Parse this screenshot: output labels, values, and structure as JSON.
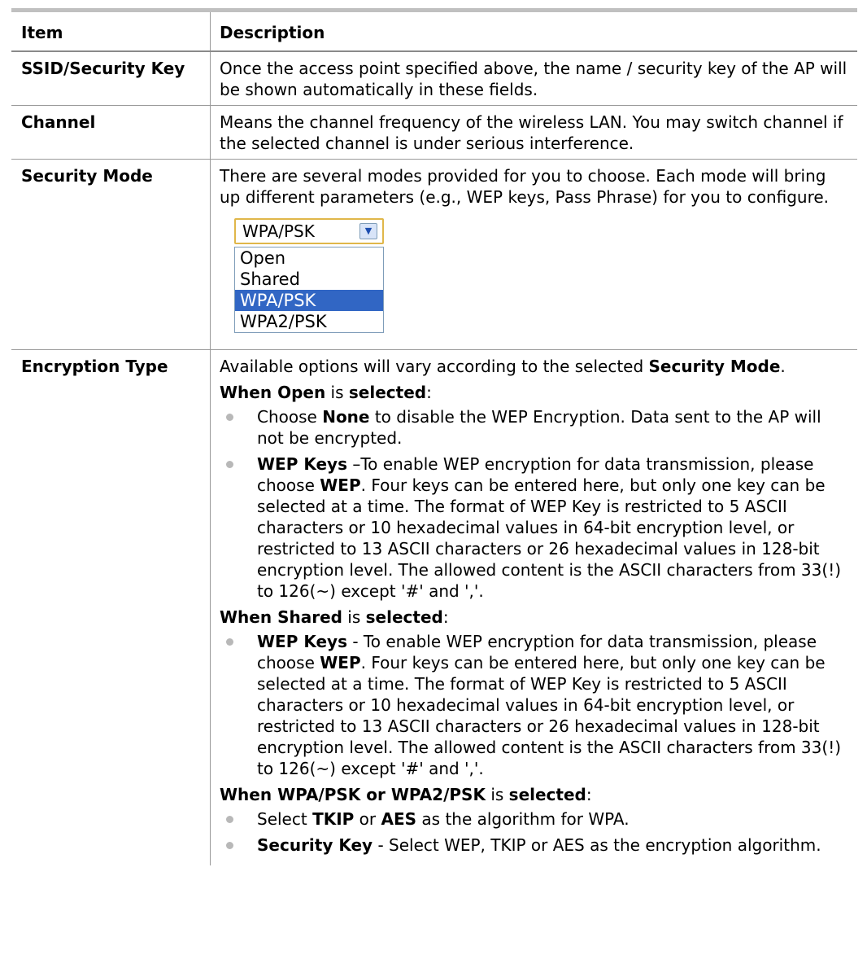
{
  "header": {
    "item": "Item",
    "description": "Description"
  },
  "rows": {
    "ssid": {
      "item": "SSID/Security Key",
      "desc": "Once the access point specified above, the name / security key of the AP will be shown automatically in these fields."
    },
    "channel": {
      "item": "Channel",
      "desc": "Means the channel frequency of the wireless LAN. You may switch channel if the selected channel is under serious interference."
    },
    "security_mode": {
      "item": "Security Mode",
      "desc": "There are several modes provided for you to choose. Each mode will bring up different parameters (e.g., WEP keys, Pass Phrase) for you to configure.",
      "dropdown": {
        "selected": "WPA/PSK",
        "options": [
          "Open",
          "Shared",
          "WPA/PSK",
          "WPA2/PSK"
        ]
      }
    },
    "encryption": {
      "item": "Encryption Type",
      "intro_a": "Available options will vary according to the selected ",
      "intro_b": "Security Mode",
      "intro_c": ".",
      "open_head_a": "When Open",
      "open_head_b": " is ",
      "open_head_c": "selected",
      "open_head_d": ":",
      "open_b1_a": "Choose ",
      "open_b1_b": "None",
      "open_b1_c": " to disable the WEP Encryption. Data sent to the AP will not be encrypted.",
      "open_b2_a": "WEP Keys",
      "open_b2_b": " –To enable WEP encryption for data transmission, please choose ",
      "open_b2_c": "WEP",
      "open_b2_d": ". Four keys can be entered here, but only one key can be selected at a time. The format of WEP Key is restricted to 5 ASCII characters or 10 hexadecimal values in 64-bit encryption level, or restricted to 13 ASCII characters or 26 hexadecimal values in 128-bit encryption level. The allowed content is the ASCII characters from 33(!) to 126(~) except '#' and ','.",
      "shared_head_a": "When Shared",
      "shared_head_b": " is ",
      "shared_head_c": "selected",
      "shared_head_d": ":",
      "shared_b1_a": "WEP Keys",
      "shared_b1_b": " - To enable WEP encryption for data transmission, please choose ",
      "shared_b1_c": "WEP",
      "shared_b1_d": ". Four keys can be entered here, but only one key can be selected at a time. The format of WEP Key is restricted to 5 ASCII characters or 10 hexadecimal values in 64-bit encryption level, or restricted to 13 ASCII characters or 26 hexadecimal values in 128-bit encryption level. The allowed content is the ASCII characters from 33(!) to 126(~) except '#' and ','.",
      "wpa_head_a": "When WPA/PSK or WPA2/PSK",
      "wpa_head_b": " is ",
      "wpa_head_c": "selected",
      "wpa_head_d": ":",
      "wpa_b1_a": "Select ",
      "wpa_b1_b": "TKIP",
      "wpa_b1_c": " or ",
      "wpa_b1_d": "AES",
      "wpa_b1_e": " as the algorithm for WPA.",
      "wpa_b2_a": "Security Key",
      "wpa_b2_b": " - Select WEP, TKIP or AES as the encryption algorithm."
    }
  }
}
